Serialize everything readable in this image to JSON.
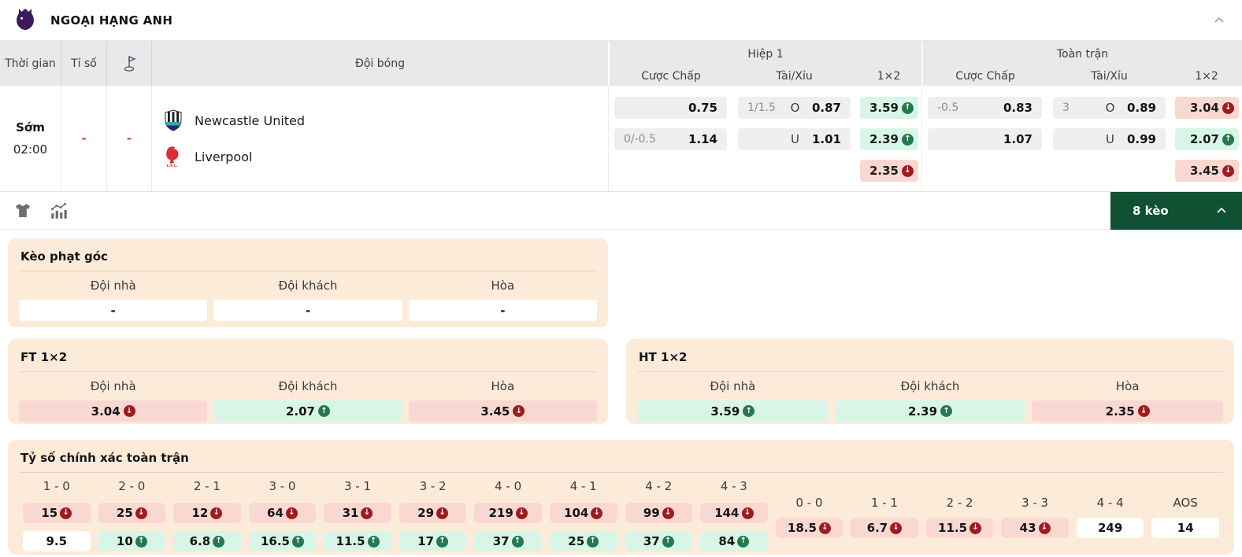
{
  "league": {
    "title": "NGOẠI HẠNG ANH"
  },
  "icons": {
    "league_logo": "premier-league-lion",
    "collapse": "chevron-up",
    "corner_column": "corner-flag",
    "jersey": "jersey",
    "stats": "stats-chart",
    "trend_up": "circle-arrow-up",
    "trend_down": "circle-arrow-down"
  },
  "colors": {
    "accent_green": "#0f5132",
    "trend_up_icon": "#27794c",
    "trend_down_icon": "#9e1b1e",
    "cell_up_bg": "#d8f6e7",
    "cell_down_bg": "#fad8d2",
    "card_bg": "#fdebd9",
    "header_bg": "#e9e9e9",
    "brand_purple": "#3d195c"
  },
  "table": {
    "head": {
      "time": "Thời gian",
      "score": "Tỉ số",
      "team": "Đội bóng",
      "half1": "Hiệp 1",
      "full": "Toàn trận",
      "handicap": "Cược Chấp",
      "over_under": "Tài/Xỉu",
      "one_x_two": "1×2"
    },
    "match": {
      "time_label": "Sớm",
      "time": "02:00",
      "score": "-",
      "corners": "-",
      "home": "Newcastle United",
      "away": "Liverpool",
      "h1": {
        "hdp": [
          {
            "line": "",
            "odds": "0.75"
          },
          {
            "line": "0/-0.5",
            "odds": "1.14"
          }
        ],
        "ou": [
          {
            "line": "1/1.5",
            "side": "O",
            "odds": "0.87"
          },
          {
            "line": "",
            "side": "U",
            "odds": "1.01"
          }
        ],
        "x12": [
          {
            "odds": "3.59",
            "trend": "up"
          },
          {
            "odds": "2.39",
            "trend": "up"
          },
          {
            "odds": "2.35",
            "trend": "down"
          }
        ]
      },
      "ft": {
        "hdp": [
          {
            "line": "-0.5",
            "odds": "0.83"
          },
          {
            "line": "",
            "odds": "1.07"
          }
        ],
        "ou": [
          {
            "line": "3",
            "side": "O",
            "odds": "0.89"
          },
          {
            "line": "",
            "side": "U",
            "odds": "0.99"
          }
        ],
        "x12": [
          {
            "odds": "3.04",
            "trend": "down"
          },
          {
            "odds": "2.07",
            "trend": "up"
          },
          {
            "odds": "3.45",
            "trend": "down"
          }
        ]
      }
    }
  },
  "toolbar": {
    "markets_label": "8 kèo"
  },
  "corner_section": {
    "title": "Kèo phạt góc",
    "headers": [
      "Đội nhà",
      "Đội khách",
      "Hòa"
    ],
    "values": [
      "-",
      "-",
      "-"
    ]
  },
  "ft_section": {
    "title": "FT 1×2",
    "headers": [
      "Đội nhà",
      "Đội khách",
      "Hòa"
    ],
    "cells": [
      {
        "odds": "3.04",
        "trend": "down"
      },
      {
        "odds": "2.07",
        "trend": "up"
      },
      {
        "odds": "3.45",
        "trend": "down"
      }
    ]
  },
  "ht_section": {
    "title": "HT 1×2",
    "headers": [
      "Đội nhà",
      "Đội khách",
      "Hòa"
    ],
    "cells": [
      {
        "odds": "3.59",
        "trend": "up"
      },
      {
        "odds": "2.39",
        "trend": "up"
      },
      {
        "odds": "2.35",
        "trend": "down"
      }
    ]
  },
  "score_section": {
    "title": "Tỷ số chính xác toàn trận",
    "win_cols": [
      {
        "label": "1 - 0",
        "top": {
          "odds": "15",
          "trend": "down"
        },
        "bottom": {
          "odds": "9.5",
          "trend": "none"
        }
      },
      {
        "label": "2 - 0",
        "top": {
          "odds": "25",
          "trend": "down"
        },
        "bottom": {
          "odds": "10",
          "trend": "up"
        }
      },
      {
        "label": "2 - 1",
        "top": {
          "odds": "12",
          "trend": "down"
        },
        "bottom": {
          "odds": "6.8",
          "trend": "up"
        }
      },
      {
        "label": "3 - 0",
        "top": {
          "odds": "64",
          "trend": "down"
        },
        "bottom": {
          "odds": "16.5",
          "trend": "up"
        }
      },
      {
        "label": "3 - 1",
        "top": {
          "odds": "31",
          "trend": "down"
        },
        "bottom": {
          "odds": "11.5",
          "trend": "up"
        }
      },
      {
        "label": "3 - 2",
        "top": {
          "odds": "29",
          "trend": "down"
        },
        "bottom": {
          "odds": "17",
          "trend": "up"
        }
      },
      {
        "label": "4 - 0",
        "top": {
          "odds": "219",
          "trend": "down"
        },
        "bottom": {
          "odds": "37",
          "trend": "up"
        }
      },
      {
        "label": "4 - 1",
        "top": {
          "odds": "104",
          "trend": "down"
        },
        "bottom": {
          "odds": "25",
          "trend": "up"
        }
      },
      {
        "label": "4 - 2",
        "top": {
          "odds": "99",
          "trend": "down"
        },
        "bottom": {
          "odds": "37",
          "trend": "up"
        }
      },
      {
        "label": "4 - 3",
        "top": {
          "odds": "144",
          "trend": "down"
        },
        "bottom": {
          "odds": "84",
          "trend": "up"
        }
      }
    ],
    "draw_cols": [
      {
        "label": "0 - 0",
        "cell": {
          "odds": "18.5",
          "trend": "down"
        }
      },
      {
        "label": "1 - 1",
        "cell": {
          "odds": "6.7",
          "trend": "down"
        }
      },
      {
        "label": "2 - 2",
        "cell": {
          "odds": "11.5",
          "trend": "down"
        }
      },
      {
        "label": "3 - 3",
        "cell": {
          "odds": "43",
          "trend": "down"
        }
      },
      {
        "label": "4 - 4",
        "cell": {
          "odds": "249",
          "trend": "none"
        }
      },
      {
        "label": "AOS",
        "cell": {
          "odds": "14",
          "trend": "none"
        }
      }
    ]
  }
}
